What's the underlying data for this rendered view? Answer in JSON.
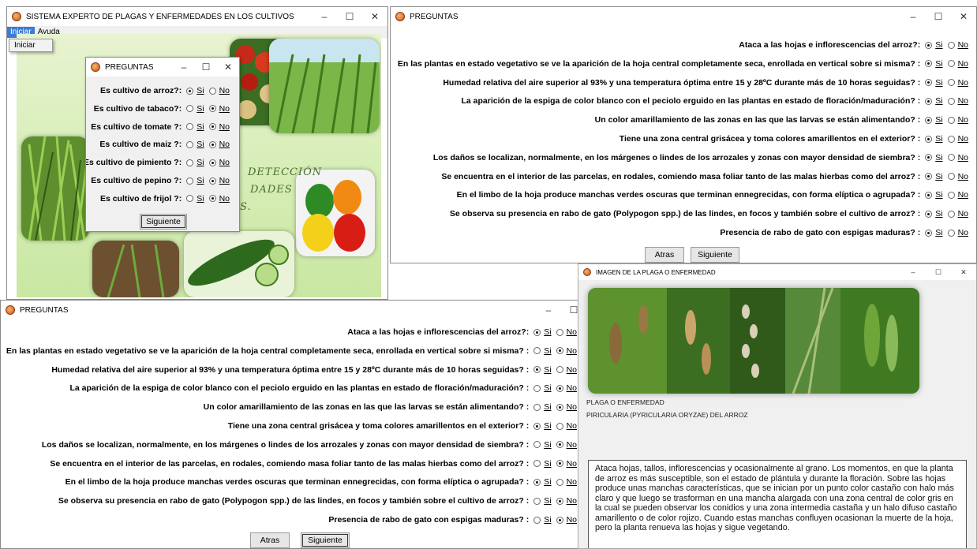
{
  "main_window": {
    "title": "SISTEMA EXPERTO DE PLAGAS Y ENFERMEDADES EN LOS CULTIVOS",
    "menu": [
      "Iniciar",
      "Ayuda"
    ],
    "dropdown_item": "Iniciar",
    "deco_lines": [
      "DETECCIÓN",
      "DADES",
      "S."
    ]
  },
  "crop_dialog": {
    "title": "PREGUNTAS",
    "questions": [
      {
        "text": "Es cultivo de arroz?:",
        "si": "Si",
        "no": "No",
        "selected": "si"
      },
      {
        "text": "Es cultivo de tabaco?:",
        "si": "Si",
        "no": "No",
        "selected": "no"
      },
      {
        "text": "Es cultivo de tomate ?:",
        "si": "Si",
        "no": "No",
        "selected": "no"
      },
      {
        "text": "Es cultivo de maiz ?:",
        "si": "Si",
        "no": "No",
        "selected": "no"
      },
      {
        "text": "Es cultivo de pimiento ?:",
        "si": "Si",
        "no": "No",
        "selected": "no"
      },
      {
        "text": "Es cultivo de pepino ?:",
        "si": "Si",
        "no": "No",
        "selected": "no"
      },
      {
        "text": "Es cultivo de frijol ?:",
        "si": "Si",
        "no": "No",
        "selected": "no"
      }
    ],
    "next_label": "Siguiente"
  },
  "questions_right": {
    "title": "PREGUNTAS",
    "questions": [
      {
        "text": "Ataca a las hojas e inflorescencias del arroz?:",
        "si": "Si",
        "no": "No",
        "selected": "si"
      },
      {
        "text": "En las plantas en estado vegetativo se ve la aparición de la hoja central completamente seca, enrollada en vertical sobre si misma? :",
        "si": "Si",
        "no": "No",
        "selected": "si"
      },
      {
        "text": "Humedad relativa del aire superior al 93% y una temperatura óptima entre 15 y 28ºC durante más de 10 horas seguidas? :",
        "si": "Si",
        "no": "No",
        "selected": "si"
      },
      {
        "text": "La aparición de la espiga de color blanco con el peciolo erguido en las plantas en estado de floración/maduración? :",
        "si": "Si",
        "no": "No",
        "selected": "si"
      },
      {
        "text": "Un color amarillamiento de las zonas en las que las larvas se están alimentando? :",
        "si": "Si",
        "no": "No",
        "selected": "si"
      },
      {
        "text": "Tiene una zona central grisácea y toma colores amarillentos en el exterior? :",
        "si": "Si",
        "no": "No",
        "selected": "si"
      },
      {
        "text": "Los daños se localizan, normalmente, en los márgenes o lindes de los arrozales y zonas con mayor densidad de siembra? :",
        "si": "Si",
        "no": "No",
        "selected": "si"
      },
      {
        "text": "Se encuentra  en el interior de las parcelas, en rodales, comiendo masa foliar tanto de las malas hierbas como del arroz? :",
        "si": "Si",
        "no": "No",
        "selected": "si"
      },
      {
        "text": "En el limbo de la hoja produce manchas verdes oscuras que terminan ennegrecidas, con forma elíptica o agrupada? :",
        "si": "Si",
        "no": "No",
        "selected": "si"
      },
      {
        "text": "Se observa su presencia en rabo de gato (Polypogon spp.) de las lindes, en focos y también sobre el cultivo de arroz? :",
        "si": "Si",
        "no": "No",
        "selected": "si"
      },
      {
        "text": "Presencia de rabo de gato con espigas maduras? :",
        "si": "Si",
        "no": "No",
        "selected": "si"
      }
    ],
    "back_label": "Atras",
    "next_label": "Siguiente"
  },
  "questions_bottom": {
    "title": "PREGUNTAS",
    "questions": [
      {
        "text": "Ataca a las hojas e inflorescencias del arroz?:",
        "si": "Si",
        "no": "No",
        "selected": "si"
      },
      {
        "text": "En las plantas en estado vegetativo se ve la aparición de la hoja central completamente seca, enrollada en vertical sobre si misma? :",
        "si": "Si",
        "no": "No",
        "selected": "no"
      },
      {
        "text": "Humedad relativa del aire superior al 93% y una temperatura óptima entre 15 y 28ºC durante más de 10 horas seguidas? :",
        "si": "Si",
        "no": "No",
        "selected": "si"
      },
      {
        "text": "La aparición de la espiga de color blanco con el peciolo erguido en las plantas en estado de floración/maduración? :",
        "si": "Si",
        "no": "No",
        "selected": "no"
      },
      {
        "text": "Un color amarillamiento de las zonas en las que las larvas se están alimentando? :",
        "si": "Si",
        "no": "No",
        "selected": "no"
      },
      {
        "text": "Tiene una zona central grisácea y toma colores amarillentos en el exterior? :",
        "si": "Si",
        "no": "No",
        "selected": "si"
      },
      {
        "text": "Los daños se localizan, normalmente, en los márgenes o lindes de los arrozales y zonas con mayor densidad de siembra? :",
        "si": "Si",
        "no": "No",
        "selected": "no"
      },
      {
        "text": "Se encuentra  en el interior de las parcelas, en rodales, comiendo masa foliar tanto de las malas hierbas como del arroz? :",
        "si": "Si",
        "no": "No",
        "selected": "no"
      },
      {
        "text": "En el limbo de la hoja produce manchas verdes oscuras que terminan ennegrecidas, con forma elíptica o agrupada? :",
        "si": "Si",
        "no": "No",
        "selected": "si"
      },
      {
        "text": "Se observa su presencia en rabo de gato (Polypogon spp.) de las lindes, en focos y también sobre el cultivo de arroz? :",
        "si": "Si",
        "no": "No",
        "selected": "no"
      },
      {
        "text": "Presencia de rabo de gato con espigas maduras? :",
        "si": "Si",
        "no": "No",
        "selected": "no"
      }
    ],
    "back_label": "Atras",
    "next_label": "Siguiente"
  },
  "image_window": {
    "title": "IMAGEN DE LA PLAGA O ENFERMEDAD",
    "caption_label": "PLAGA O ENFERMEDAD",
    "pest_name": "PIRICULARIA (PYRICULARIA ORYZAE)  DEL ARROZ",
    "description": "Ataca hojas, tallos, inflorescencias y ocasionalmente al grano. Los momentos, en que la planta de arroz es más susceptible, son el estado de plántula y durante la floración. Sobre las hojas produce unas manchas características, que se inician por un punto color castaño con halo más claro y que luego se trasforman en una mancha alargada con una zona central de color gris en la cual se pueden observar los conidios y una zona intermedia castaña y un halo difuso castaño amarillento o de color rojizo. Cuando estas manchas confluyen ocasionan la muerte de la hoja, pero la planta renueva las hojas y sigue vegetando."
  },
  "window_controls": {
    "minimize": "–",
    "maximize": "☐",
    "close": "✕"
  }
}
